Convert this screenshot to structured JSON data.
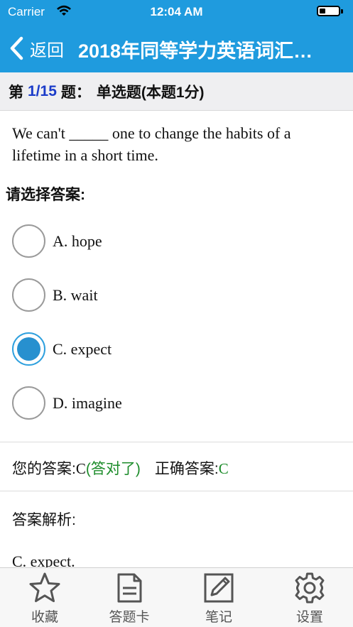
{
  "status_bar": {
    "carrier": "Carrier",
    "time": "12:04 AM"
  },
  "nav": {
    "back_label": "返回",
    "title": "2018年同等学力英语词汇…"
  },
  "question_header": {
    "prefix": "第",
    "number": "1/15",
    "suffix": "题：",
    "type": "单选题(本题1分)"
  },
  "question": {
    "text": "We can't _____ one to change the habits of a lifetime in a short time."
  },
  "prompt": "请选择答案:",
  "options": [
    {
      "label": "A. hope",
      "selected": false
    },
    {
      "label": "B. wait",
      "selected": false
    },
    {
      "label": "C. expect",
      "selected": true
    },
    {
      "label": "D. imagine",
      "selected": false
    }
  ],
  "answer": {
    "your_label": "您的答案:",
    "your_value": "C",
    "status": "(答对了)",
    "correct_label": "正确答案:",
    "correct_value": "C"
  },
  "analysis": {
    "label": "答案解析:",
    "text": "C. expect."
  },
  "tabbar": {
    "items": [
      {
        "label": "收藏",
        "icon": "star-icon"
      },
      {
        "label": "答题卡",
        "icon": "document-icon"
      },
      {
        "label": "笔记",
        "icon": "edit-note-icon"
      },
      {
        "label": "设置",
        "icon": "gear-icon"
      }
    ]
  },
  "colors": {
    "header": "#1f9bde",
    "question_number": "#1b3cc9",
    "radio_selected": "#2790cf",
    "correct_text": "#1c8c2a"
  }
}
